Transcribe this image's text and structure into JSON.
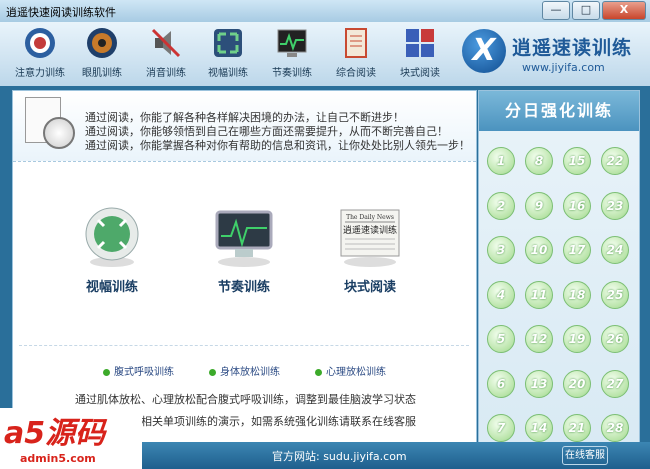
{
  "window": {
    "title": "逍遥快速阅读训练软件",
    "min": "—",
    "max": "□",
    "close": "X"
  },
  "toolbar": [
    {
      "label": "注意力训练",
      "icon": "target-icon",
      "color": "#c43b3b"
    },
    {
      "label": "眼肌训练",
      "icon": "eye-icon",
      "color": "#c77a2a"
    },
    {
      "label": "消音训练",
      "icon": "speaker-mute-icon",
      "color": "#b33"
    },
    {
      "label": "视幅训练",
      "icon": "expand-icon",
      "color": "#3aa06a"
    },
    {
      "label": "节奏训练",
      "icon": "monitor-pulse-icon",
      "color": "#2a8f4a"
    },
    {
      "label": "综合阅读",
      "icon": "book-icon",
      "color": "#c84a32"
    },
    {
      "label": "块式阅读",
      "icon": "block-grid-icon",
      "color": "#3a5fb8"
    }
  ],
  "logo": {
    "mark": "X",
    "name": "逍遥速读训练",
    "url": "www.jiyifa.com"
  },
  "banner": {
    "lines": [
      "通过阅读，你能了解各种各样解决困境的办法，让自己不断进步！",
      "通过阅读，你能够领悟到自己在哪些方面还需要提升，从而不断完善自己！",
      "通过阅读，你能掌握各种对你有帮助的信息和资讯，让你处处比别人领先一步！"
    ]
  },
  "features": [
    {
      "name": "视幅训练"
    },
    {
      "name": "节奏训练"
    },
    {
      "name": "块式阅读",
      "paper": "The Daily News",
      "paper_title": "逍遥速读训练"
    }
  ],
  "relax": [
    "腹式呼吸训练",
    "身体放松训练",
    "心理放松训练"
  ],
  "description": [
    "通过肌体放松、心理放松配合腹式呼吸训练，调整到最佳脑波学习状态",
    "相关单项训练的演示，如需系统强化训练请联系在线客服"
  ],
  "right_panel": {
    "title": "分日强化训练",
    "days": [
      1,
      8,
      15,
      22,
      2,
      9,
      16,
      23,
      3,
      10,
      17,
      24,
      4,
      11,
      18,
      25,
      5,
      12,
      19,
      26,
      6,
      13,
      20,
      27,
      7,
      14,
      21,
      28
    ]
  },
  "bottom": {
    "site": "官方网站: sudu.jiyifa.com",
    "service": "在线客服"
  },
  "watermark": {
    "main": "a5源码",
    "url": "admin5.com"
  }
}
